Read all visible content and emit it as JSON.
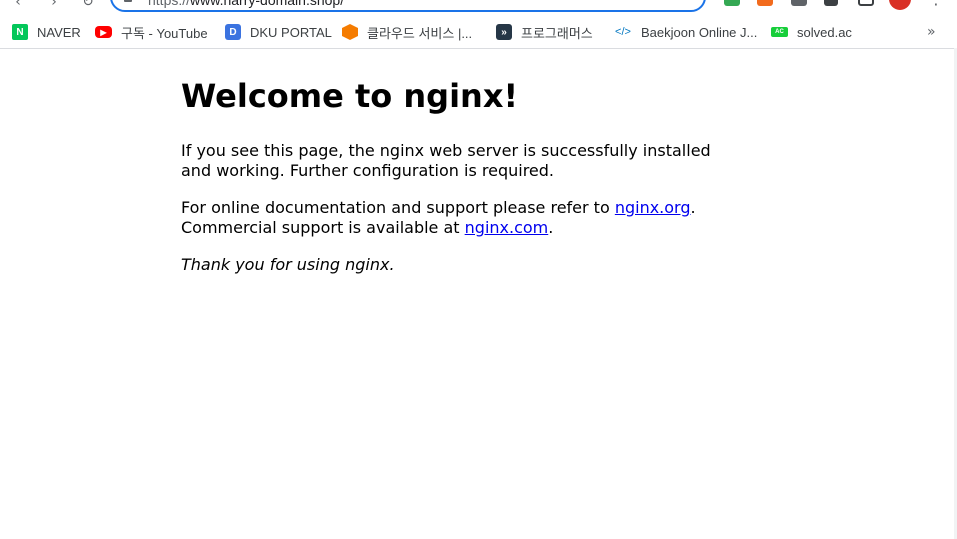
{
  "browser": {
    "url_scheme": "https://",
    "url_host": "www.harry-domain.shop/",
    "more_bookmarks_glyph": "»",
    "bookmarks": [
      {
        "label": "NAVER",
        "icon": "naver-icon",
        "fav_text": "N",
        "color": "#03c75a"
      },
      {
        "label": "구독 - YouTube",
        "icon": "youtube-icon",
        "fav_text": "▶",
        "color": "#ff0000"
      },
      {
        "label": "DKU PORTAL",
        "icon": "dku-portal-icon",
        "fav_text": "D",
        "color": "#3b73e0"
      },
      {
        "label": "클라우드 서비스 |...",
        "icon": "cloud-service-icon",
        "fav_text": "",
        "color": "#f57c00"
      },
      {
        "label": "프로그래머스",
        "icon": "programmers-icon",
        "fav_text": "»",
        "color": "#263747"
      },
      {
        "label": "Baekjoon Online J...",
        "icon": "baekjoon-icon",
        "fav_text": "</>",
        "color": "#0076c0"
      },
      {
        "label": "solved.ac",
        "icon": "solved-ac-icon",
        "fav_text": "AC",
        "color": "#17ce3a"
      }
    ]
  },
  "page": {
    "title": "Welcome to nginx!",
    "para1": "If you see this page, the nginx web server is successfully installed and working. Further configuration is required.",
    "para2_prefix": "For online documentation and support please refer to ",
    "link_org": "nginx.org",
    "para2_mid": ".",
    "para2_line2_prefix": "Commercial support is available at ",
    "link_com": "nginx.com",
    "para2_suffix": ".",
    "thanks": "Thank you for using nginx."
  }
}
